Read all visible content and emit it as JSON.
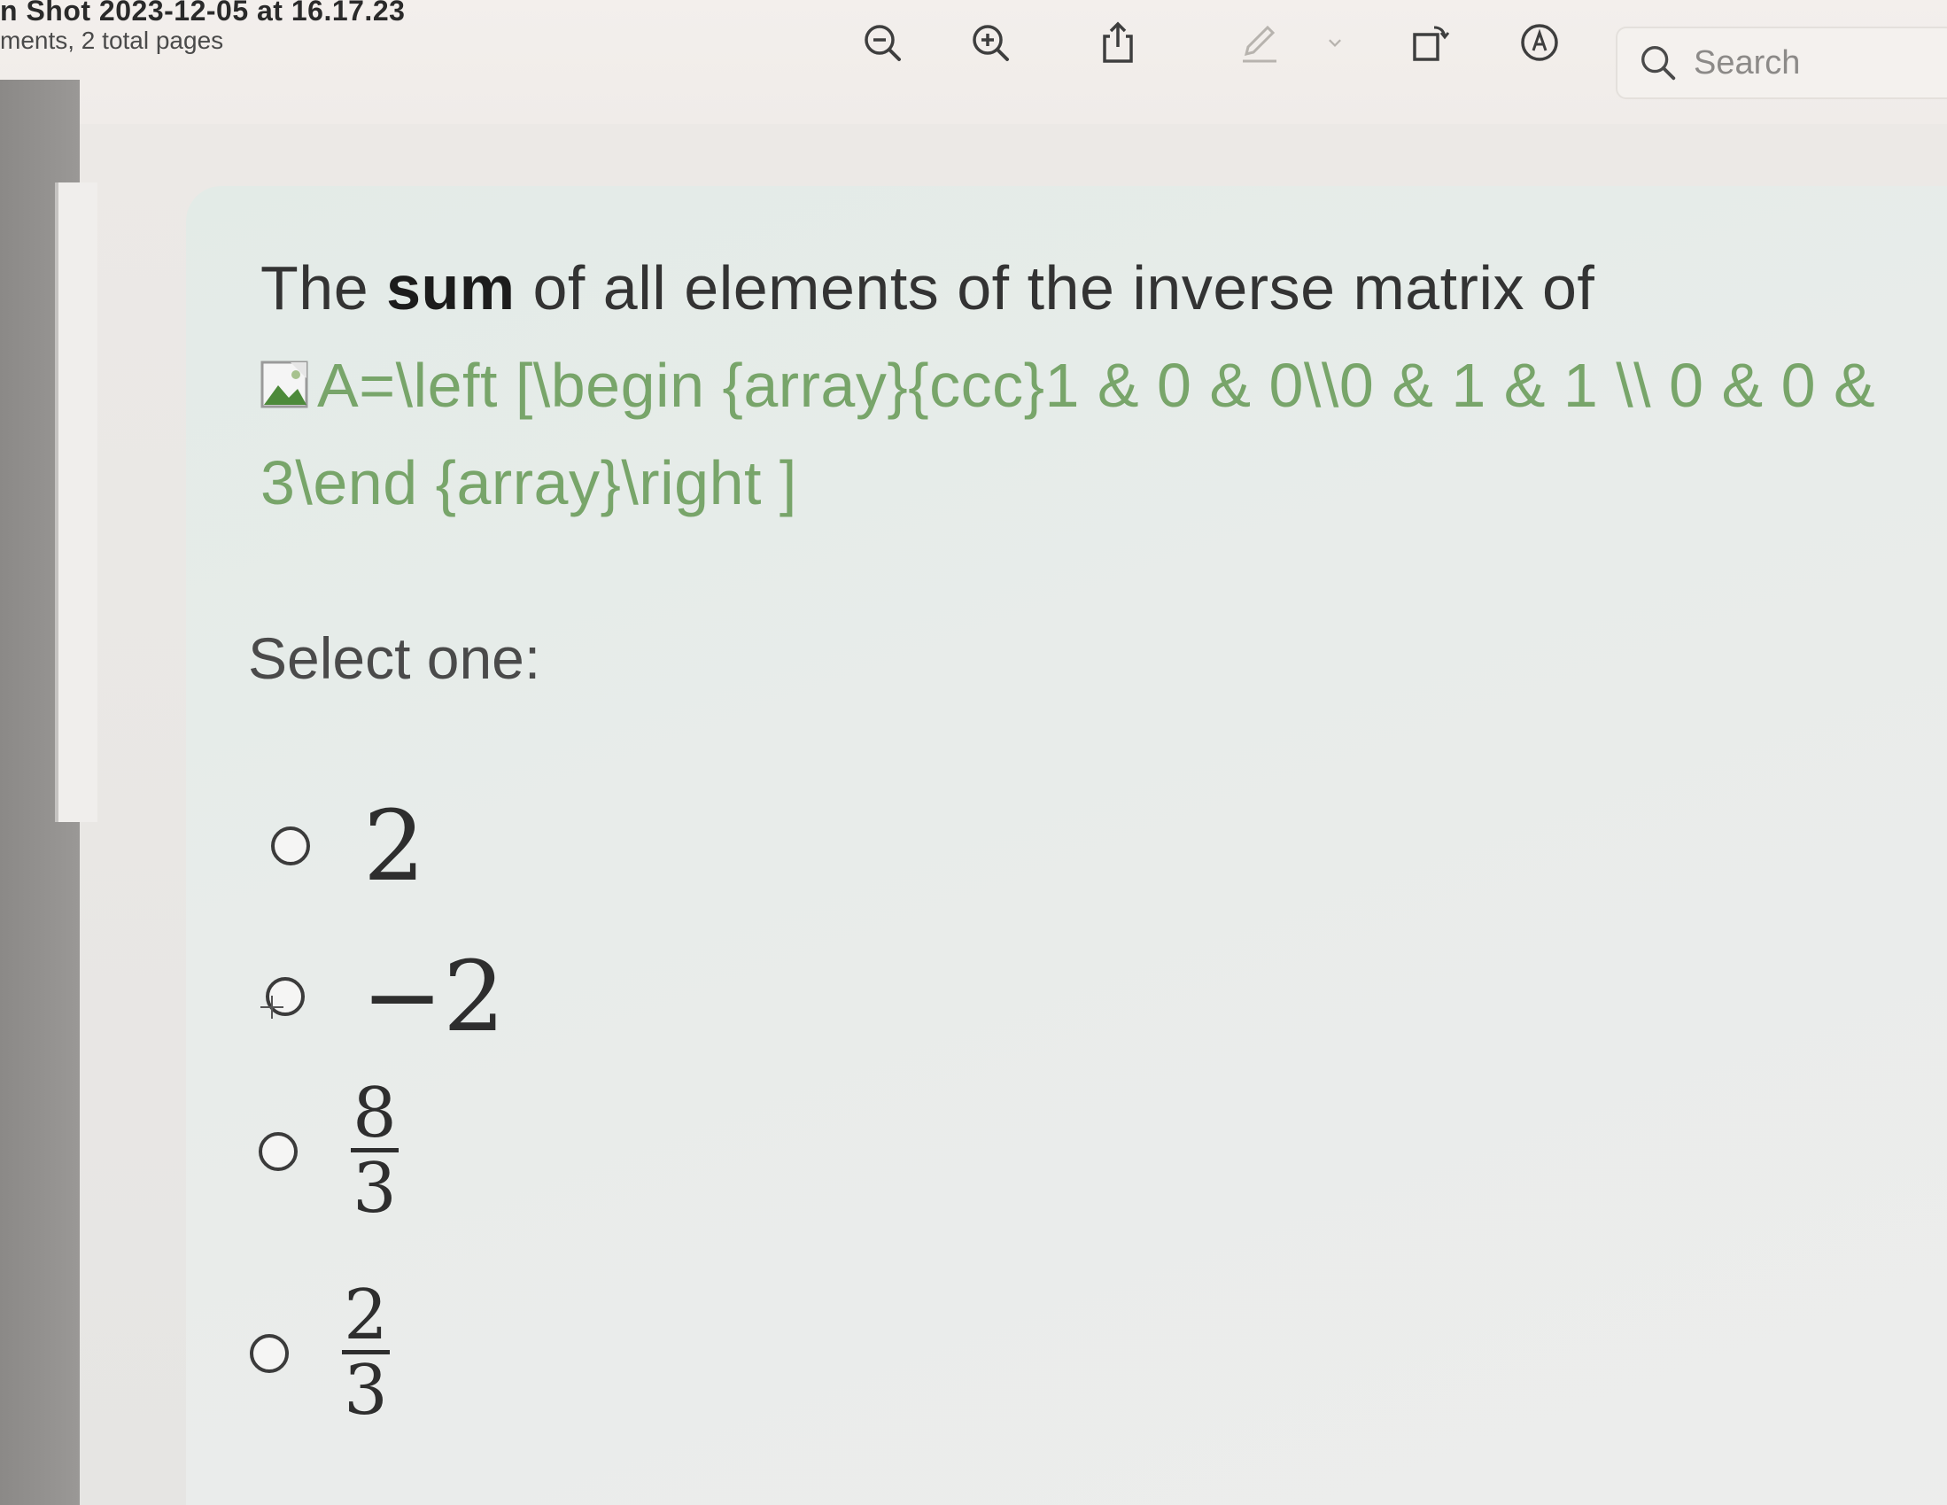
{
  "window": {
    "title": "n Shot 2023-12-05 at 16.17.23",
    "subtitle": "ments, 2 total pages"
  },
  "toolbar": {
    "icons": [
      "zoom-out-icon",
      "zoom-in-icon",
      "share-icon",
      "markup-pen-icon",
      "chevron-down-icon",
      "rotate-icon",
      "markup-circle-icon"
    ],
    "search_placeholder": "Search"
  },
  "question": {
    "prefix": "The ",
    "bold_word": "sum",
    "suffix": " of all elements of the inverse matrix of",
    "latex_line1": "A=\\left [\\begin {array}{ccc}1 & 0 & 0\\\\0 & 1 & 1 \\\\ 0 & 0 &",
    "latex_line2": "3\\end {array}\\right ]"
  },
  "select_label": "Select one:",
  "options": [
    {
      "type": "number",
      "value": "2"
    },
    {
      "type": "number",
      "value": "−2"
    },
    {
      "type": "fraction",
      "numerator": "8",
      "denominator": "3"
    },
    {
      "type": "fraction",
      "numerator": "2",
      "denominator": "3"
    }
  ],
  "colors": {
    "latex_text": "#78a56a",
    "card_bg": "#e3ebe7"
  }
}
